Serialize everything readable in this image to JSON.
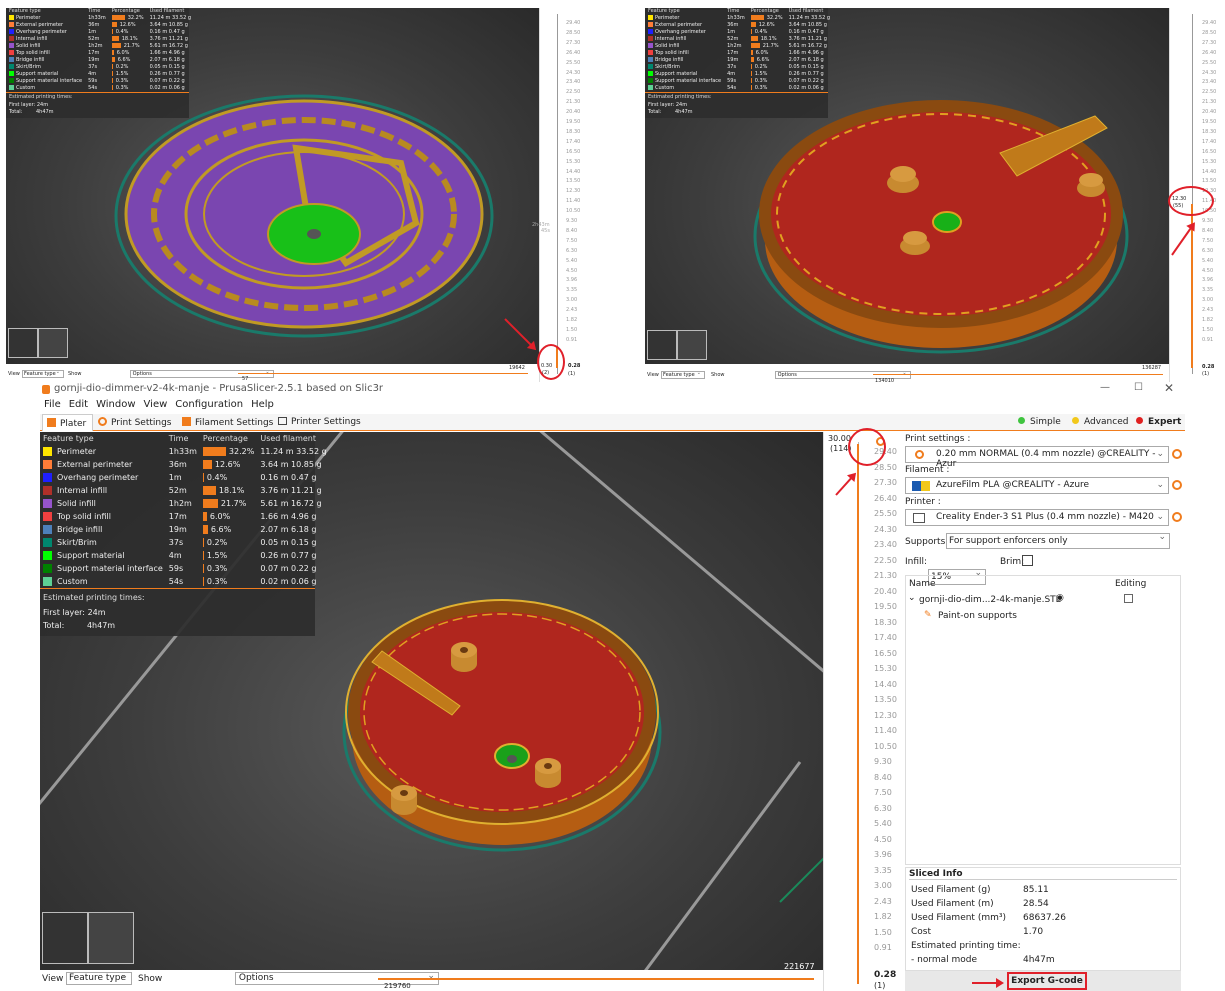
{
  "legend": {
    "headers": [
      "Feature type",
      "Time",
      "Percentage",
      "Used filament"
    ],
    "rows": [
      {
        "name": "Perimeter",
        "color": "#ffe600",
        "time": "1h33m",
        "pct": "32.2%",
        "len": "11.24 m",
        "wt": "33.52 g",
        "share": 0.322
      },
      {
        "name": "External perimeter",
        "color": "#ff7d38",
        "time": "36m",
        "pct": "12.6%",
        "len": "3.64 m",
        "wt": "10.85 g",
        "share": 0.126
      },
      {
        "name": "Overhang perimeter",
        "color": "#1f1fff",
        "time": "1m",
        "pct": "0.4%",
        "len": "0.16 m",
        "wt": "0.47 g",
        "share": 0.004
      },
      {
        "name": "Internal infill",
        "color": "#b03029",
        "time": "52m",
        "pct": "18.1%",
        "len": "3.76 m",
        "wt": "11.21 g",
        "share": 0.181
      },
      {
        "name": "Solid infill",
        "color": "#9654cc",
        "time": "1h2m",
        "pct": "21.7%",
        "len": "5.61 m",
        "wt": "16.72 g",
        "share": 0.217
      },
      {
        "name": "Top solid infill",
        "color": "#f04040",
        "time": "17m",
        "pct": "6.0%",
        "len": "1.66 m",
        "wt": "4.96 g",
        "share": 0.06
      },
      {
        "name": "Bridge infill",
        "color": "#4d80ba",
        "time": "19m",
        "pct": "6.6%",
        "len": "2.07 m",
        "wt": "6.18 g",
        "share": 0.066
      },
      {
        "name": "Skirt/Brim",
        "color": "#00876e",
        "time": "37s",
        "pct": "0.2%",
        "len": "0.05 m",
        "wt": "0.15 g",
        "share": 0.002
      },
      {
        "name": "Support material",
        "color": "#00ff00",
        "time": "4m",
        "pct": "1.5%",
        "len": "0.26 m",
        "wt": "0.77 g",
        "share": 0.015
      },
      {
        "name": "Support material interface",
        "color": "#008000",
        "time": "59s",
        "pct": "0.3%",
        "len": "0.07 m",
        "wt": "0.22 g",
        "share": 0.003
      },
      {
        "name": "Custom",
        "color": "#5ed194",
        "time": "54s",
        "pct": "0.3%",
        "len": "0.02 m",
        "wt": "0.06 g",
        "share": 0.003
      }
    ],
    "est_title": "Estimated printing times:",
    "first_layer_label": "First layer:",
    "first_layer": "24m",
    "total_label": "Total:",
    "total": "4h47m"
  },
  "ticks": [
    "29.40",
    "28.50",
    "27.30",
    "26.40",
    "25.50",
    "24.30",
    "23.40",
    "22.50",
    "21.30",
    "20.40",
    "19.50",
    "18.30",
    "17.40",
    "16.50",
    "15.30",
    "14.40",
    "13.50",
    "12.30",
    "11.40",
    "10.50",
    "9.30",
    "8.40",
    "7.50",
    "6.30",
    "5.40",
    "4.50",
    "3.96",
    "3.35",
    "3.00",
    "2.43",
    "1.82",
    "1.50",
    "0.91"
  ],
  "top_left": {
    "view_label": "View",
    "view_value": "Feature type",
    "show_label": "Show",
    "show_value": "Options",
    "h_left": "57",
    "h_right": "19642",
    "top_value": "0.30",
    "top_layer": "(2)",
    "bottom_value": "0.28",
    "bottom_layer": "(1)",
    "mid_label": "2h43m",
    "mid_label2": "45s"
  },
  "top_right": {
    "view_label": "View",
    "view_value": "Feature type",
    "show_label": "Show",
    "show_value": "Options",
    "h_left": "134010",
    "h_right": "136287",
    "cursor_value": "12.30",
    "cursor_layer": "(55)",
    "bottom_value": "0.28",
    "bottom_layer": "(1)"
  },
  "window": {
    "title": "gornji-dio-dimmer-v2-4k-manje - PrusaSlicer-2.5.1 based on Slic3r",
    "menu": [
      "File",
      "Edit",
      "Window",
      "View",
      "Configuration",
      "Help"
    ],
    "tabs": [
      "Plater",
      "Print Settings",
      "Filament Settings",
      "Printer Settings"
    ],
    "modes": [
      {
        "label": "Simple",
        "color": "#3fc43f"
      },
      {
        "label": "Advanced",
        "color": "#f2c81b"
      },
      {
        "label": "Expert",
        "color": "#e02020"
      }
    ]
  },
  "main": {
    "top_value": "30.00",
    "top_layer": "(114)",
    "bottom_value": "0.28",
    "bottom_layer": "(1)",
    "h_right": "221677",
    "h_left": "219760",
    "view_label": "View",
    "view_value": "Feature type",
    "show_label": "Show",
    "show_value": "Options"
  },
  "panel": {
    "print_label": "Print settings :",
    "print_value": "0.20 mm NORMAL (0.4 mm nozzle) @CREALITY - Azur",
    "filament_label": "Filament :",
    "filament_value": "AzureFilm PLA @CREALITY - Azure",
    "printer_label": "Printer :",
    "printer_value": "Creality Ender-3 S1 Plus (0.4 mm nozzle) - M420",
    "supports_label": "Supports:",
    "supports_value": "For support enforcers only",
    "infill_label": "Infill:",
    "infill_value": "15%",
    "brim_label": "Brim:",
    "col_name": "Name",
    "col_editing": "Editing",
    "object_name": "gornji-dio-dim...2-4k-manje.STL",
    "paint_label": "Paint-on supports",
    "sliced_title": "Sliced Info",
    "sliced": [
      {
        "k": "Used Filament (g)",
        "v": "85.11"
      },
      {
        "k": "Used Filament (m)",
        "v": "28.54"
      },
      {
        "k": "Used Filament (mm³)",
        "v": "68637.26"
      },
      {
        "k": "Cost",
        "v": "1.70"
      },
      {
        "k": "Estimated printing time:",
        "v": ""
      },
      {
        "k": "- normal mode",
        "v": "4h47m"
      }
    ],
    "export_label": "Export G-code"
  }
}
